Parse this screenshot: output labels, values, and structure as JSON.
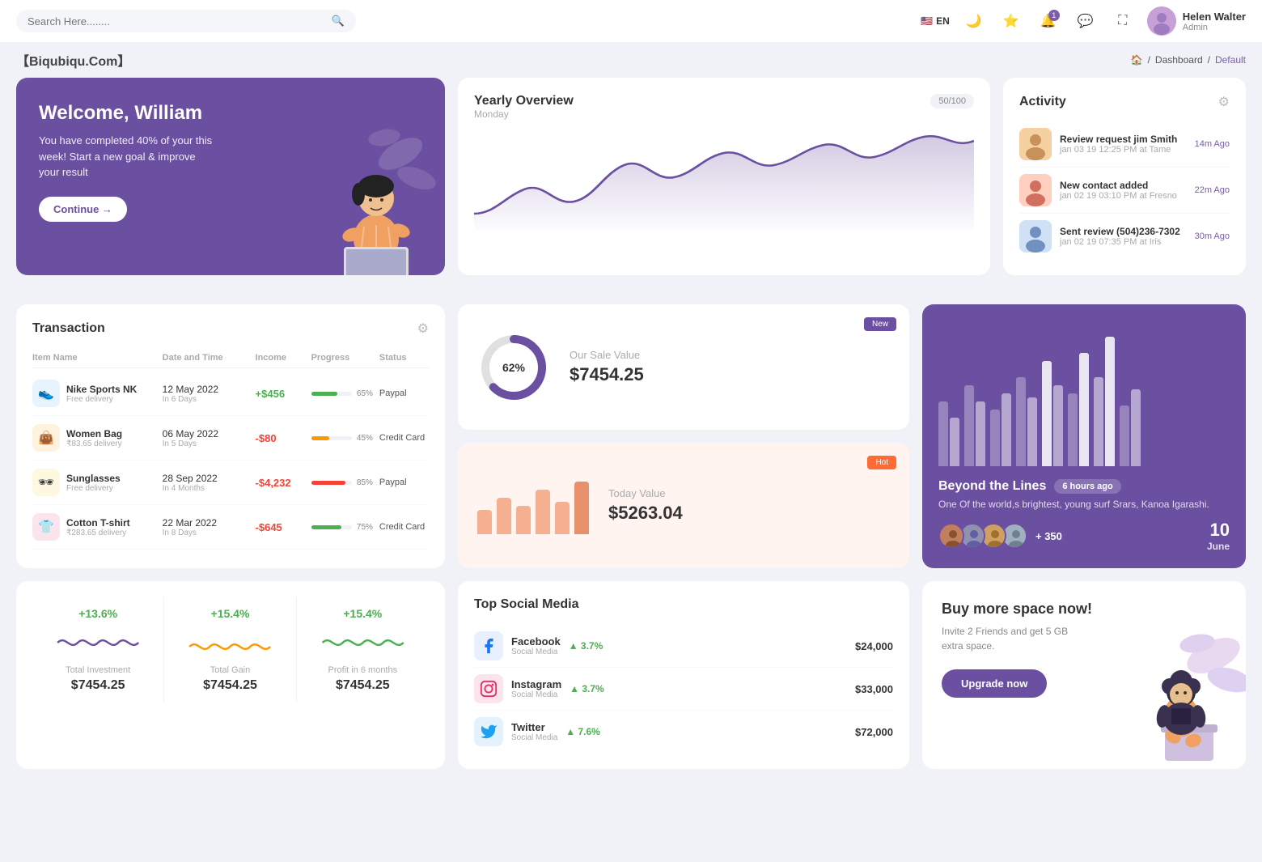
{
  "topnav": {
    "search_placeholder": "Search Here........",
    "lang": "EN",
    "user": {
      "name": "Helen Walter",
      "role": "Admin"
    },
    "notification_count": "1"
  },
  "breadcrumb": {
    "brand": "【Biqubiqu.Com】",
    "home": "🏠",
    "dashboard": "Dashboard",
    "current": "Default"
  },
  "welcome": {
    "title": "Welcome, William",
    "description": "You have completed 40% of your this week! Start a new goal & improve your result",
    "button": "Continue →"
  },
  "yearly": {
    "title": "Yearly Overview",
    "subtitle": "Monday",
    "badge": "50/100"
  },
  "activity": {
    "title": "Activity",
    "items": [
      {
        "title": "Review request jim Smith",
        "sub": "jan 03 19 12:25 PM at Tame",
        "time": "14m Ago"
      },
      {
        "title": "New contact added",
        "sub": "jan 02 19 03:10 PM at Fresno",
        "time": "22m Ago"
      },
      {
        "title": "Sent review (504)236-7302",
        "sub": "jan 02 19 07:35 PM at Iris",
        "time": "30m Ago"
      }
    ]
  },
  "transaction": {
    "title": "Transaction",
    "columns": [
      "Item Name",
      "Date and Time",
      "Income",
      "Progress",
      "Status"
    ],
    "rows": [
      {
        "name": "Nike Sports NK",
        "sub": "Free delivery",
        "date": "12 May 2022",
        "days": "In 6 Days",
        "income": "+$456",
        "income_type": "pos",
        "progress": 65,
        "progress_color": "#4caf50",
        "status": "Paypal",
        "icon": "👟",
        "icon_bg": "#e8f4fd"
      },
      {
        "name": "Women Bag",
        "sub": "₹83.65 delivery",
        "date": "06 May 2022",
        "days": "In 5 Days",
        "income": "-$80",
        "income_type": "neg",
        "progress": 45,
        "progress_color": "#ff9800",
        "status": "Credit Card",
        "icon": "👜",
        "icon_bg": "#fff3e0"
      },
      {
        "name": "Sunglasses",
        "sub": "Free delivery",
        "date": "28 Sep 2022",
        "days": "In 4 Months",
        "income": "-$4,232",
        "income_type": "neg",
        "progress": 85,
        "progress_color": "#f44336",
        "status": "Paypal",
        "icon": "🕶",
        "icon_bg": "#fff8e1"
      },
      {
        "name": "Cotton T-shirt",
        "sub": "₹283.65 delivery",
        "date": "22 Mar 2022",
        "days": "In 8 Days",
        "income": "-$645",
        "income_type": "neg",
        "progress": 75,
        "progress_color": "#4caf50",
        "status": "Credit Card",
        "icon": "👕",
        "icon_bg": "#fce4ec"
      }
    ]
  },
  "sale_value": {
    "label": "Our Sale Value",
    "value": "$7454.25",
    "percent": "62%",
    "badge": "New"
  },
  "today_value": {
    "label": "Today Value",
    "value": "$5263.04",
    "badge": "Hot"
  },
  "beyond": {
    "title": "Beyond the Lines",
    "time": "6 hours ago",
    "description": "One Of the world,s brightest, young surf Srars, Kanoa Igarashi.",
    "plus_count": "+ 350",
    "date": "10",
    "month": "June"
  },
  "stats": [
    {
      "percent": "+13.6%",
      "label": "Total Investment",
      "value": "$7454.25",
      "color": "#6b4fa0"
    },
    {
      "percent": "+15.4%",
      "label": "Total Gain",
      "value": "$7454.25",
      "color": "#ff9800"
    },
    {
      "percent": "+15.4%",
      "label": "Profit in 6 months",
      "value": "$7454.25",
      "color": "#4caf50"
    }
  ],
  "social": {
    "title": "Top Social Media",
    "items": [
      {
        "name": "Facebook",
        "sub": "Social Media",
        "change": "3.7%",
        "amount": "$24,000",
        "color": "#1877f2",
        "bg": "#e8f0fe"
      },
      {
        "name": "Instagram",
        "sub": "Social Media",
        "change": "3.7%",
        "amount": "$33,000",
        "color": "#e1306c",
        "bg": "#fce4ec"
      },
      {
        "name": "Twitter",
        "sub": "Social Media",
        "change": "7.6%",
        "amount": "$72,000",
        "color": "#1da1f2",
        "bg": "#e3f2fd"
      }
    ]
  },
  "buy_space": {
    "title": "Buy more space now!",
    "description": "Invite 2 Friends and get 5 GB extra space.",
    "button": "Upgrade now"
  }
}
